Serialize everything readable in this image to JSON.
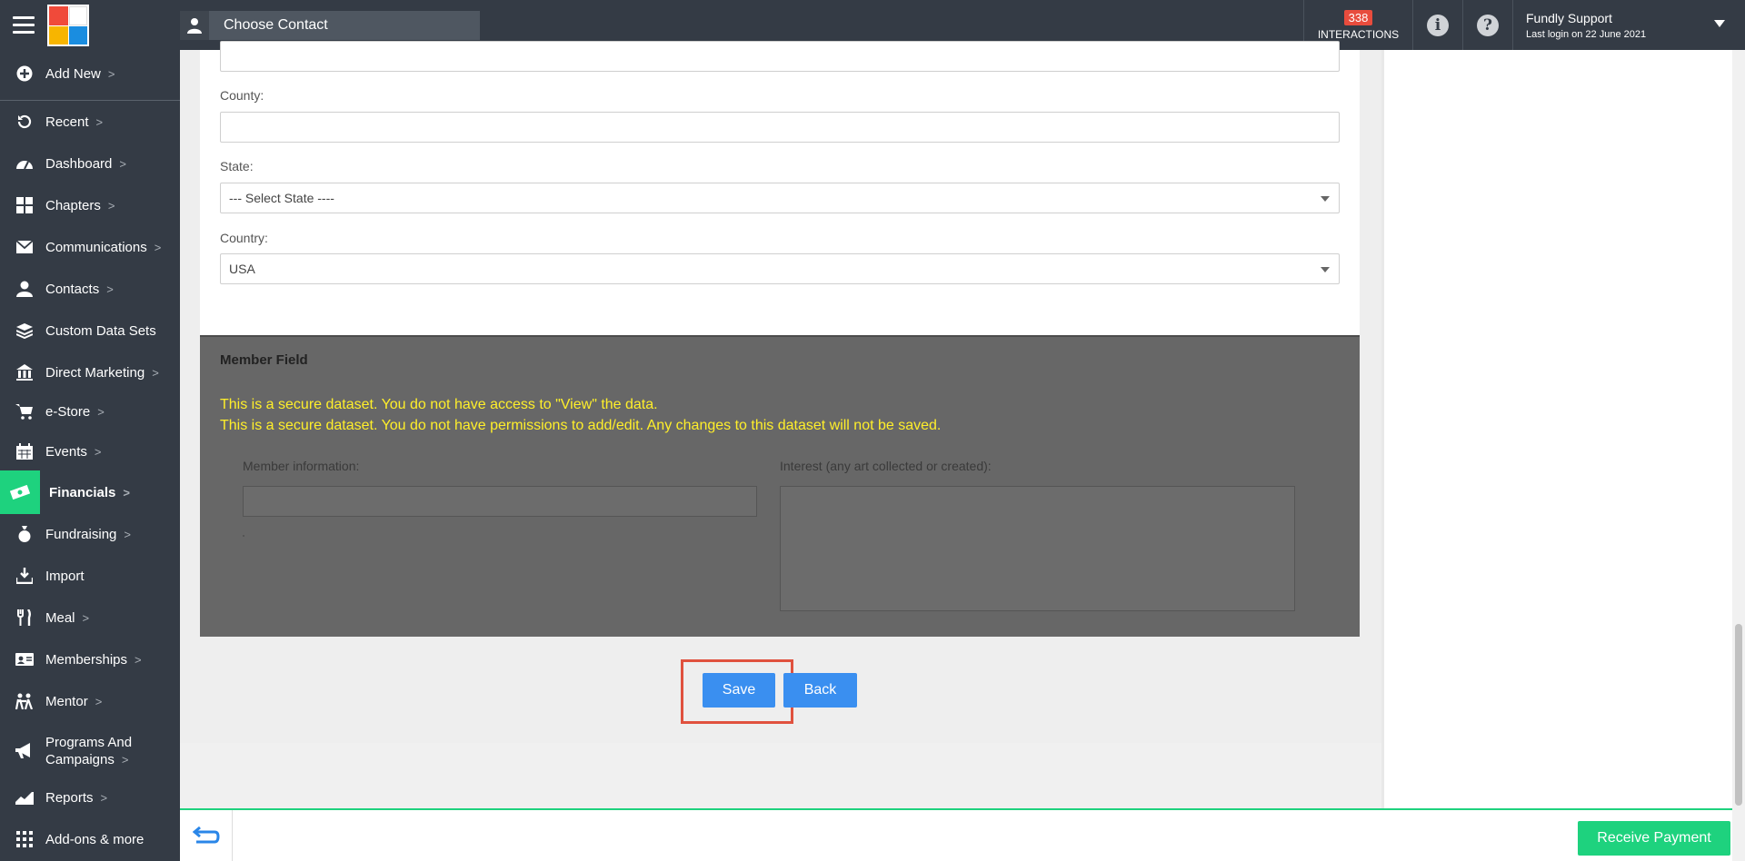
{
  "header": {
    "contact_picker_label": "Choose Contact",
    "interactions_count": "338",
    "interactions_label": "INTERACTIONS",
    "info_icon": "i",
    "help_icon": "?",
    "user_name": "Fundly Support",
    "last_login": "Last login on 22 June 2021"
  },
  "sidebar": {
    "items": [
      {
        "label": "Add New",
        "chevron": ">",
        "icon": "plus-circle-icon"
      },
      {
        "label": "Recent",
        "chevron": ">",
        "icon": "history-icon"
      },
      {
        "label": "Dashboard",
        "chevron": ">",
        "icon": "dashboard-icon"
      },
      {
        "label": "Chapters",
        "chevron": ">",
        "icon": "grid-icon"
      },
      {
        "label": "Communications",
        "chevron": ">",
        "icon": "envelope-icon"
      },
      {
        "label": "Contacts",
        "chevron": ">",
        "icon": "person-icon"
      },
      {
        "label": "Custom Data Sets",
        "chevron": "",
        "icon": "layers-icon"
      },
      {
        "label": "Direct Marketing",
        "chevron": ">",
        "icon": "bank-icon"
      },
      {
        "label": "e-Store",
        "chevron": ">",
        "icon": "cart-icon"
      },
      {
        "label": "Events",
        "chevron": ">",
        "icon": "calendar-icon"
      },
      {
        "label": "Financials",
        "chevron": ">",
        "icon": "money-icon"
      },
      {
        "label": "Fundraising",
        "chevron": ">",
        "icon": "money-bag-icon"
      },
      {
        "label": "Import",
        "chevron": "",
        "icon": "import-icon"
      },
      {
        "label": "Meal",
        "chevron": ">",
        "icon": "cutlery-icon"
      },
      {
        "label": "Memberships",
        "chevron": ">",
        "icon": "id-card-icon"
      },
      {
        "label": "Mentor",
        "chevron": ">",
        "icon": "mentor-icon"
      },
      {
        "label": "Programs And",
        "label2": "Campaigns",
        "chevron": ">",
        "icon": "megaphone-icon"
      },
      {
        "label": "Reports",
        "chevron": ">",
        "icon": "chart-icon"
      },
      {
        "label": "Add-ons & more",
        "chevron": "",
        "icon": "apps-icon"
      }
    ]
  },
  "form": {
    "county_label": "County:",
    "county_value": "",
    "state_label": "State:",
    "state_value": "--- Select State ----",
    "country_label": "Country:",
    "country_value": "USA"
  },
  "member_field": {
    "title": "Member Field",
    "warning_view": "This is a secure dataset. You do not have access to \"View\" the data.",
    "warning_edit": "This is a secure dataset. You do not have permissions to add/edit. Any changes to this dataset will not be saved.",
    "member_info_label": "Member information:",
    "interest_label": "Interest (any art collected or created):"
  },
  "actions": {
    "save_label": "Save",
    "back_label": "Back"
  },
  "bottombar": {
    "receive_payment_label": "Receive Payment"
  },
  "colors": {
    "topbar": "#343b45",
    "accent_green": "#1ed27e",
    "button_blue": "#3a8ff0",
    "warning_yellow": "#ffef2a",
    "badge_red": "#e84c3d",
    "highlight_red": "#e0513e"
  }
}
